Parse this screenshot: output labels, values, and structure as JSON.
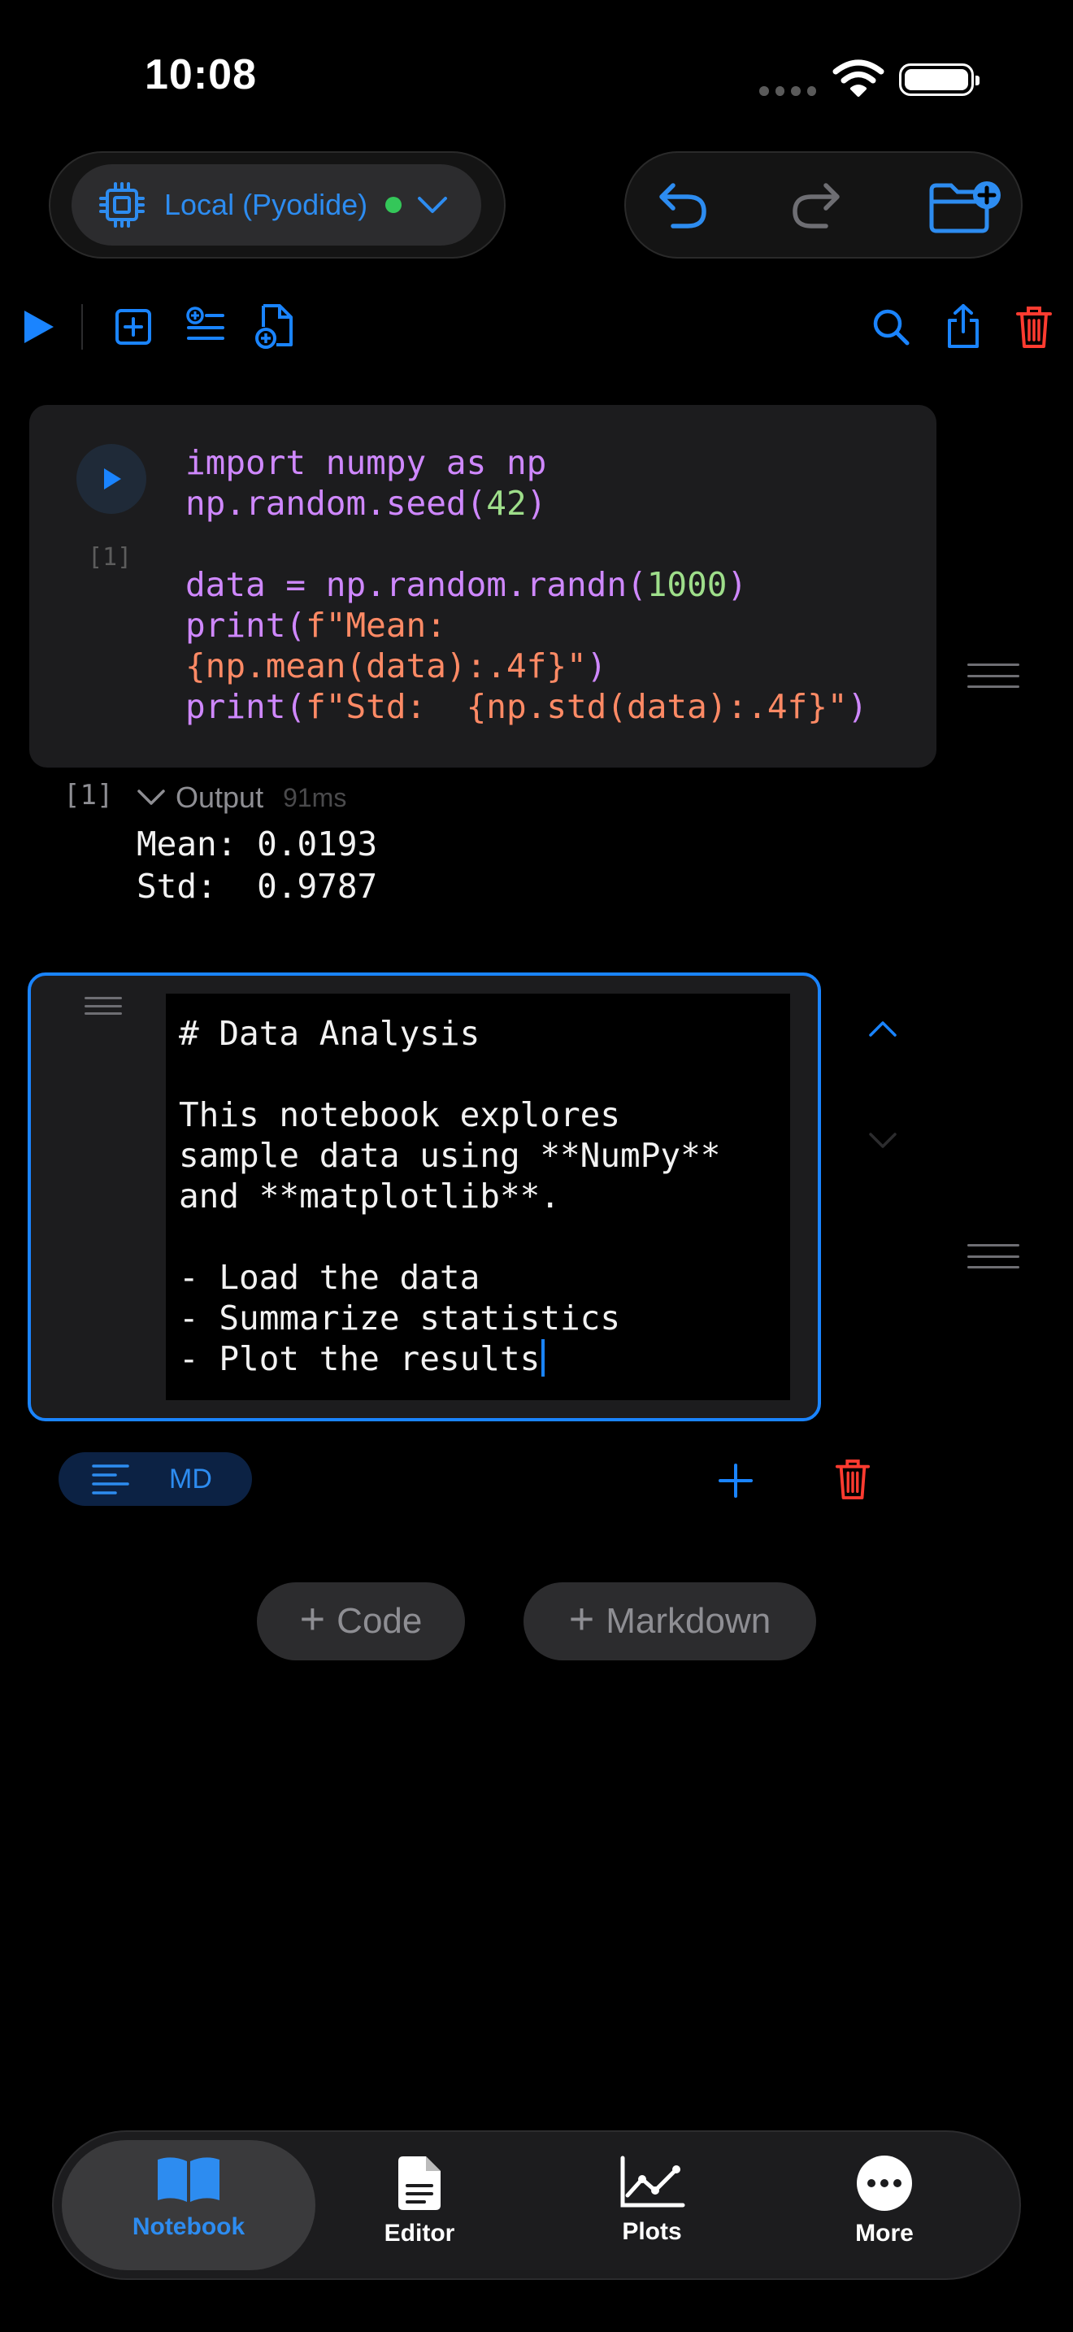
{
  "status_bar": {
    "time": "10:08"
  },
  "kernel": {
    "label": "Local (Pyodide)",
    "status_color": "#34c759"
  },
  "colors": {
    "accent": "#1a84ff",
    "danger": "#ff3b30",
    "surface": "#1c1c1e"
  },
  "toolbar": {
    "left_icons": [
      "run-all-icon",
      "add-cell-icon",
      "insert-list-icon",
      "new-document-icon"
    ],
    "right_icons": [
      "search-icon",
      "share-icon",
      "trash-icon"
    ]
  },
  "cell1": {
    "exec_count": "[1]",
    "code": {
      "l1": "import numpy as np",
      "l2a": "np.random.seed(",
      "l2b": "42",
      "l2c": ")",
      "l3a": "data = np.random.randn(",
      "l3b": "1000",
      "l3c": ")",
      "l4a": "print(",
      "l4b": "f\"Mean:",
      "l5a": "{np.mean(data):.4f}\"",
      "l5b": ")",
      "l6a": "print(",
      "l6b": "f\"Std:  {np.std(data):.4f}\"",
      "l6c": ")"
    },
    "output": {
      "count": "[1]",
      "label": "Output",
      "duration": "91ms",
      "lines": [
        "Mean: 0.0193",
        "Std:  0.9787"
      ]
    }
  },
  "cell2": {
    "lines": [
      "# Data Analysis",
      "",
      "This notebook explores",
      "sample data using **NumPy**",
      "and **matplotlib**.",
      "",
      "- Load the data",
      "- Summarize statistics",
      "- Plot the results"
    ],
    "type_label": "MD"
  },
  "add_buttons": {
    "code": "Code",
    "markdown": "Markdown"
  },
  "tabs": [
    {
      "label": "Notebook",
      "icon": "book-icon",
      "active": true
    },
    {
      "label": "Editor",
      "icon": "document-icon",
      "active": false
    },
    {
      "label": "Plots",
      "icon": "chart-icon",
      "active": false
    },
    {
      "label": "More",
      "icon": "more-icon",
      "active": false
    }
  ]
}
